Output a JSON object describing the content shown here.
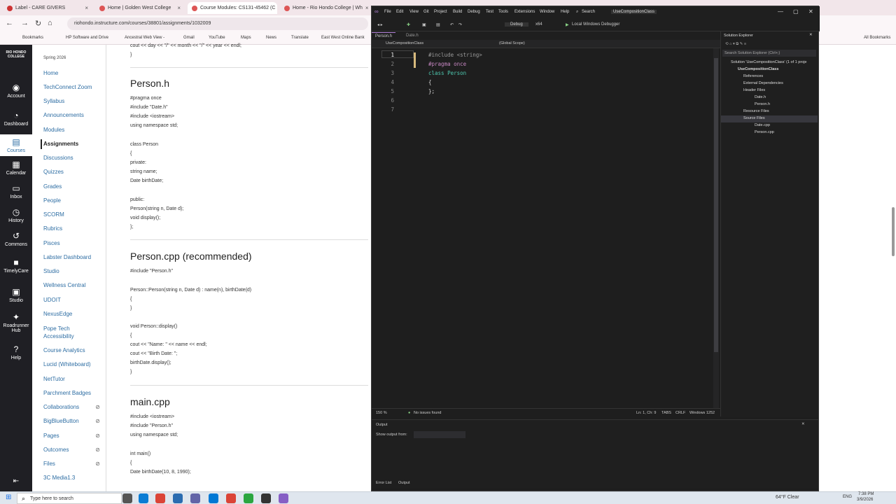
{
  "browser": {
    "tabs": [
      {
        "label": "Label - CARE GIVERS"
      },
      {
        "label": "Home | Golden West College"
      },
      {
        "label": "Course Modules: CS131-45462 (C"
      },
      {
        "label": "Home - Rio Hondo College | Wh"
      }
    ],
    "url": "riohondo.instructure.com/courses/38801/assignments/1032009",
    "bookmarks": [
      "Bookmarks",
      "HP Software and Drive",
      "Ancestral Web View -",
      "Gmail",
      "YouTube",
      "Maps",
      "News",
      "Translate",
      "East West Online Bank"
    ],
    "all_bookmarks": "All Bookmarks"
  },
  "rail": {
    "logo": "RIO HONDO COLLEGE",
    "items": [
      "Account",
      "Dashboard",
      "Courses",
      "Calendar",
      "Inbox",
      "History",
      "Commons",
      "TimelyCare",
      "Studio",
      "Roadrunner Hub",
      "Help"
    ]
  },
  "course_nav": {
    "term": "Spring 2026",
    "items": [
      "Home",
      "TechConnect Zoom",
      "Syllabus",
      "Announcements",
      "Modules",
      "Assignments",
      "Discussions",
      "Quizzes",
      "Grades",
      "People",
      "SCORM",
      "Rubrics",
      "Pisces",
      "Labster Dashboard",
      "Studio",
      "Wellness Central",
      "UDOIT",
      "NexusEdge",
      "Pope Tech Accessibility",
      "Course Analytics",
      "Lucid (Whiteboard)",
      "NetTutor",
      "Parchment Badges",
      "Collaborations",
      "BigBlueButton",
      "Pages",
      "Outcomes",
      "Files",
      "3C Media1.3"
    ],
    "active": "Assignments"
  },
  "content": {
    "top_lines": [
      "cout << day << \"/\" << month << \"/\" << year << endl;",
      "}"
    ],
    "h_person_h": "Person.h",
    "person_h_code": [
      "#pragma once",
      "#include \"Date.h\"",
      "#include <iostream>",
      "using namespace std;",
      "",
      "class Person",
      "{",
      "private:",
      "string name;",
      "Date birthDate;",
      "",
      "public:",
      "Person(string n, Date d);",
      "void display();",
      "};"
    ],
    "h_person_cpp": "Person.cpp (recommended)",
    "person_cpp_code": [
      "#include \"Person.h\"",
      "",
      "Person::Person(string n, Date d) : name(n), birthDate(d)",
      "{",
      "}",
      "",
      "void Person::display()",
      "{",
      "cout << \"Name: \" << name << endl;",
      "cout << \"Birth Date: \";",
      "birthDate.display();",
      "}"
    ],
    "h_main_cpp": "main.cpp",
    "main_cpp_code": [
      "#include <iostream>",
      "#include \"Person.h\"",
      "using namespace std;",
      "",
      "int main()",
      "{",
      "Date birthDate(10, 8, 1990);"
    ]
  },
  "vs": {
    "menu": [
      "File",
      "Edit",
      "View",
      "Git",
      "Project",
      "Build",
      "Debug",
      "Test",
      "Tools",
      "Extensions",
      "Window",
      "Help",
      "Search"
    ],
    "title": "UseCompositionClass",
    "toolbar": {
      "config": "Debug",
      "platform": "x64",
      "run": "Local Windows Debugger"
    },
    "doc_tabs": [
      "Person.h",
      "Date.h"
    ],
    "nav_project": "UseCompositionClass",
    "nav_scope": "(Global Scope)",
    "code_lines": [
      {
        "n": "1",
        "text": "#include <string>"
      },
      {
        "n": "2",
        "text": "#pragma once"
      },
      {
        "n": "3",
        "text": "class Person"
      },
      {
        "n": "4",
        "text": "{"
      },
      {
        "n": "5",
        "text": "};"
      },
      {
        "n": "6",
        "text": ""
      },
      {
        "n": "7",
        "text": ""
      }
    ],
    "status": {
      "zoom": "150 %",
      "issues": "No issues found",
      "position": "Ln: 1, Ch: 9",
      "tabs": "TABS",
      "eol": "CRLF",
      "encoding": "Windows 1252"
    },
    "solution_explorer": {
      "title": "Solution Explorer",
      "search": "Search Solution Explorer (Ctrl+;)",
      "items": [
        "Solution 'UseCompositionClass' (1 of 1 proje",
        "UseCompositionClass",
        "References",
        "External Dependencies",
        "Header Files",
        "Date.h",
        "Person.h",
        "Resource Files",
        "Source Files",
        "Date.cpp",
        "Person.cpp"
      ]
    },
    "output": {
      "title": "Output",
      "show_from": "Show output from:"
    },
    "bottom_tabs": [
      "Error List",
      "Output"
    ]
  },
  "taskbar": {
    "search": "Type here to search",
    "weather": "64°F Clear",
    "lang": "ENG",
    "time": "7:38 PM",
    "date": "3/9/2026"
  }
}
